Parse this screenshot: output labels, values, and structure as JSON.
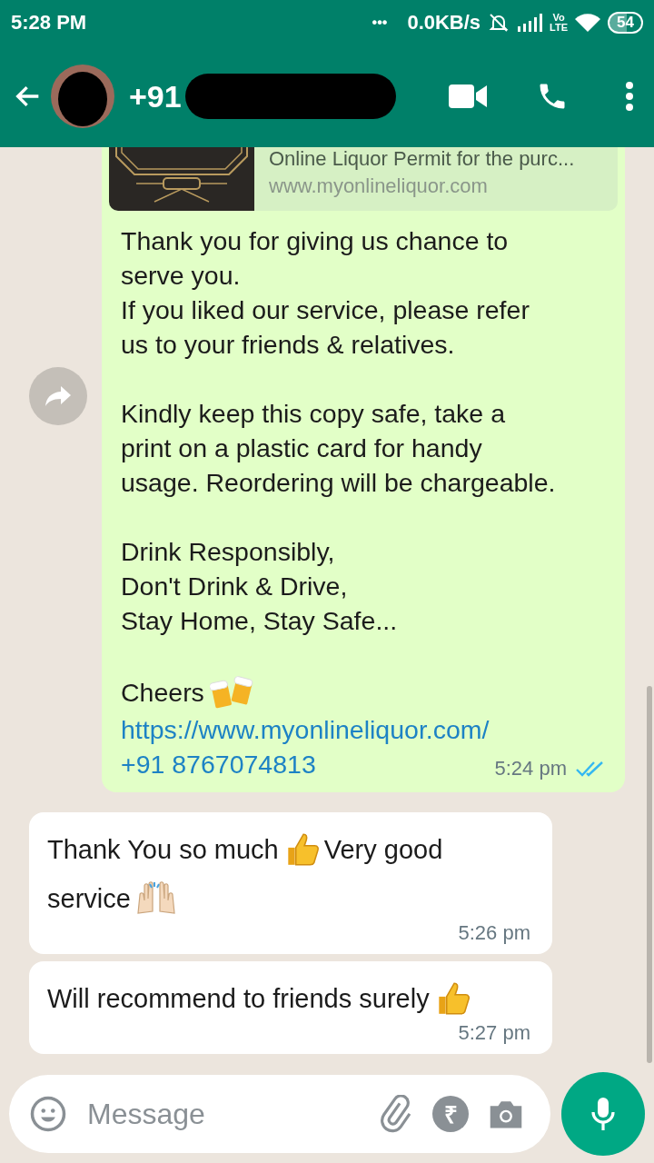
{
  "status_bar": {
    "time": "5:28 PM",
    "more": "•••",
    "speed": "0.0KB/s",
    "volte_top": "Vo",
    "volte_bottom": "LTE",
    "battery": "54"
  },
  "header": {
    "name": "+91"
  },
  "outgoing": {
    "preview": {
      "title": "Online Liquor Permit for the purc...",
      "domain": "www.myonlineliquor.com"
    },
    "paragraphs": [
      [
        "Thank you for giving us chance to",
        "serve you.",
        "If you liked our service, please refer",
        "us to your friends & relatives."
      ],
      [
        "Kindly keep this copy safe, take a",
        "print on a plastic card for handy",
        "usage. Reordering will be chargeable."
      ],
      [
        "Drink Responsibly,",
        "Don't Drink & Drive,",
        "Stay Home, Stay Safe..."
      ]
    ],
    "closing": "Cheers",
    "link": "https://www.myonlineliquor.com/",
    "phone": "+91 8767074813",
    "time": "5:24 pm",
    "read": true
  },
  "incoming": [
    {
      "lines": [
        [
          {
            "kind": "text",
            "text": "Thank You so much"
          },
          {
            "kind": "thumbs"
          },
          {
            "kind": "text",
            "text": "Very good"
          }
        ],
        [
          {
            "kind": "text",
            "text": "service"
          },
          {
            "kind": "hands"
          }
        ]
      ],
      "time": "5:26 pm"
    },
    {
      "lines": [
        [
          {
            "kind": "text",
            "text": "Will recommend to friends surely"
          },
          {
            "kind": "thumbs"
          }
        ]
      ],
      "time": "5:27 pm"
    }
  ],
  "composer": {
    "placeholder": "Message",
    "payment_symbol": "₹"
  }
}
